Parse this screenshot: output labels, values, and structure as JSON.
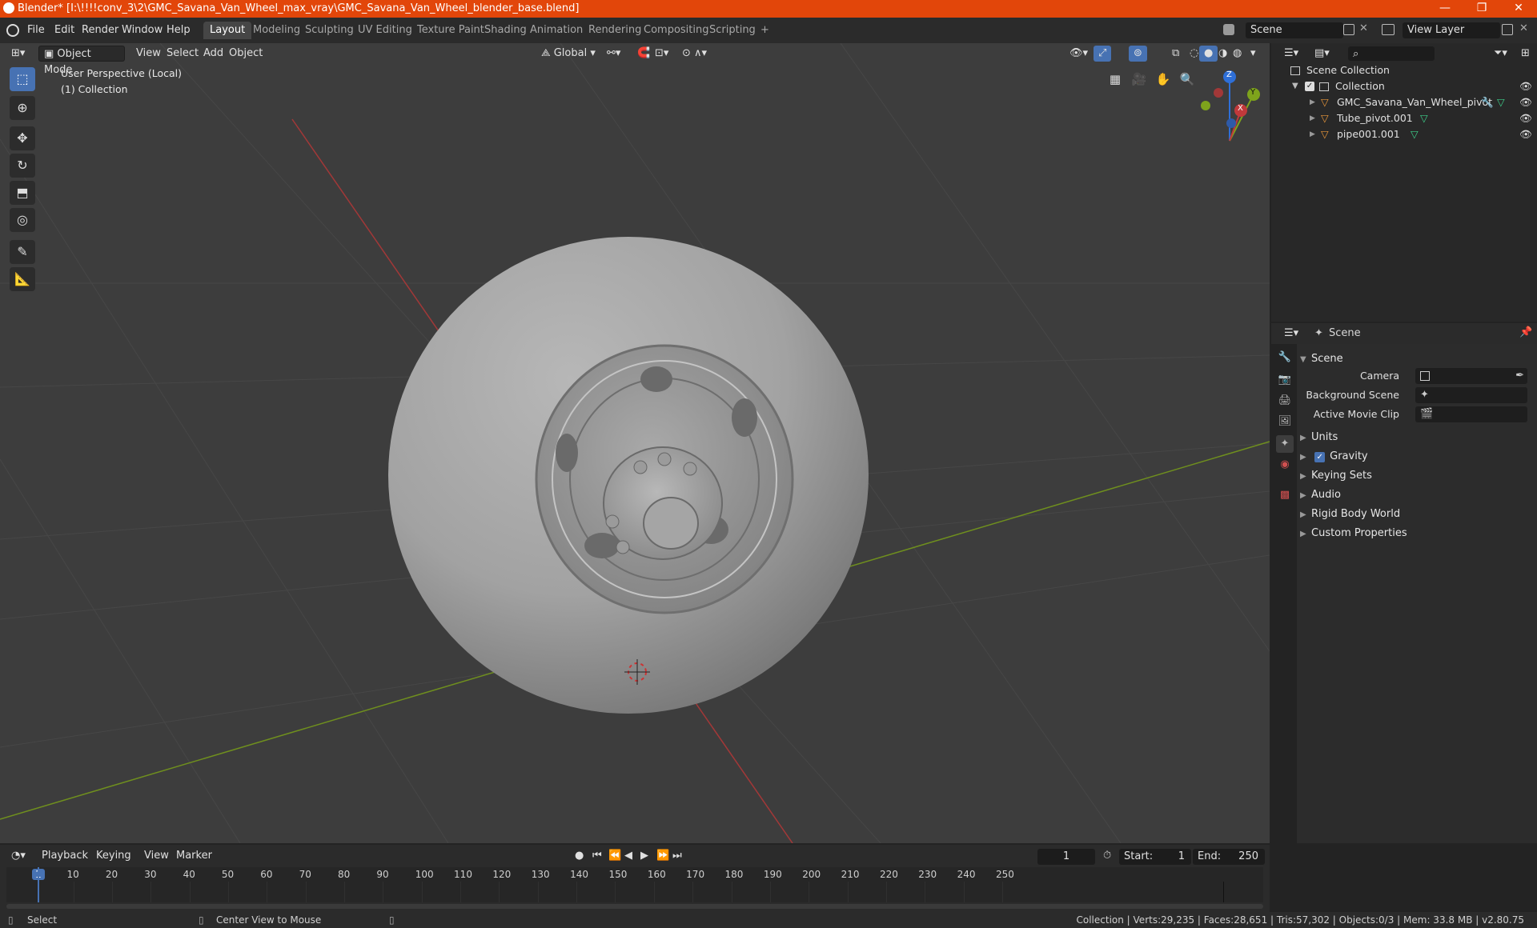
{
  "window": {
    "title": "Blender* [I:\\!!!!conv_3\\2\\GMC_Savana_Van_Wheel_max_vray\\GMC_Savana_Van_Wheel_blender_base.blend]",
    "minimize": "—",
    "maximize": "❐",
    "close": "✕"
  },
  "menu": [
    "File",
    "Edit",
    "Render",
    "Window",
    "Help"
  ],
  "workspaces": [
    "Layout",
    "Modeling",
    "Sculpting",
    "UV Editing",
    "Texture Paint",
    "Shading",
    "Animation",
    "Rendering",
    "Compositing",
    "Scripting"
  ],
  "workspace_add": "+",
  "scene_field": "Scene",
  "view_layer_field": "View Layer",
  "viewport": {
    "mode": "Object Mode",
    "menus": [
      "View",
      "Select",
      "Add",
      "Object"
    ],
    "orientation": "Global",
    "perspective_text": "User Perspective (Local)",
    "collection_text": "(1) Collection",
    "gizmo": {
      "z": "Z",
      "y": "Y",
      "x": "X"
    }
  },
  "outliner": {
    "root": "Scene Collection",
    "collection": "Collection",
    "objects": [
      "GMC_Savana_Van_Wheel_pivot",
      "Tube_pivot.001",
      "pipe001.001"
    ]
  },
  "properties": {
    "header": "Scene",
    "panel_title": "Scene",
    "fields": {
      "camera": "Camera",
      "background_scene": "Background Scene",
      "active_movie_clip": "Active Movie Clip"
    },
    "panels": [
      "Units",
      "Gravity",
      "Keying Sets",
      "Audio",
      "Rigid Body World",
      "Custom Properties"
    ]
  },
  "timeline": {
    "menus": [
      "Playback",
      "Keying",
      "View",
      "Marker"
    ],
    "current_frame": "1",
    "start_label": "Start:",
    "start": "1",
    "end_label": "End:",
    "end": "250",
    "ticks": [
      "1",
      "10",
      "20",
      "30",
      "40",
      "50",
      "60",
      "70",
      "80",
      "90",
      "100",
      "110",
      "120",
      "130",
      "140",
      "150",
      "160",
      "170",
      "180",
      "190",
      "200",
      "210",
      "220",
      "230",
      "240",
      "250"
    ]
  },
  "status": {
    "left": "Select",
    "middle": "Center View to Mouse",
    "right": "Collection | Verts:29,235 | Faces:28,651 | Tris:57,302 | Objects:0/3 | Mem: 33.8 MB | v2.80.75"
  },
  "colors": {
    "title_bar": "#e2460a",
    "active_tool": "#4772b3",
    "axis_x": "#c0393b",
    "axis_y": "#7ea31c",
    "axis_z": "#2e6fd8"
  }
}
